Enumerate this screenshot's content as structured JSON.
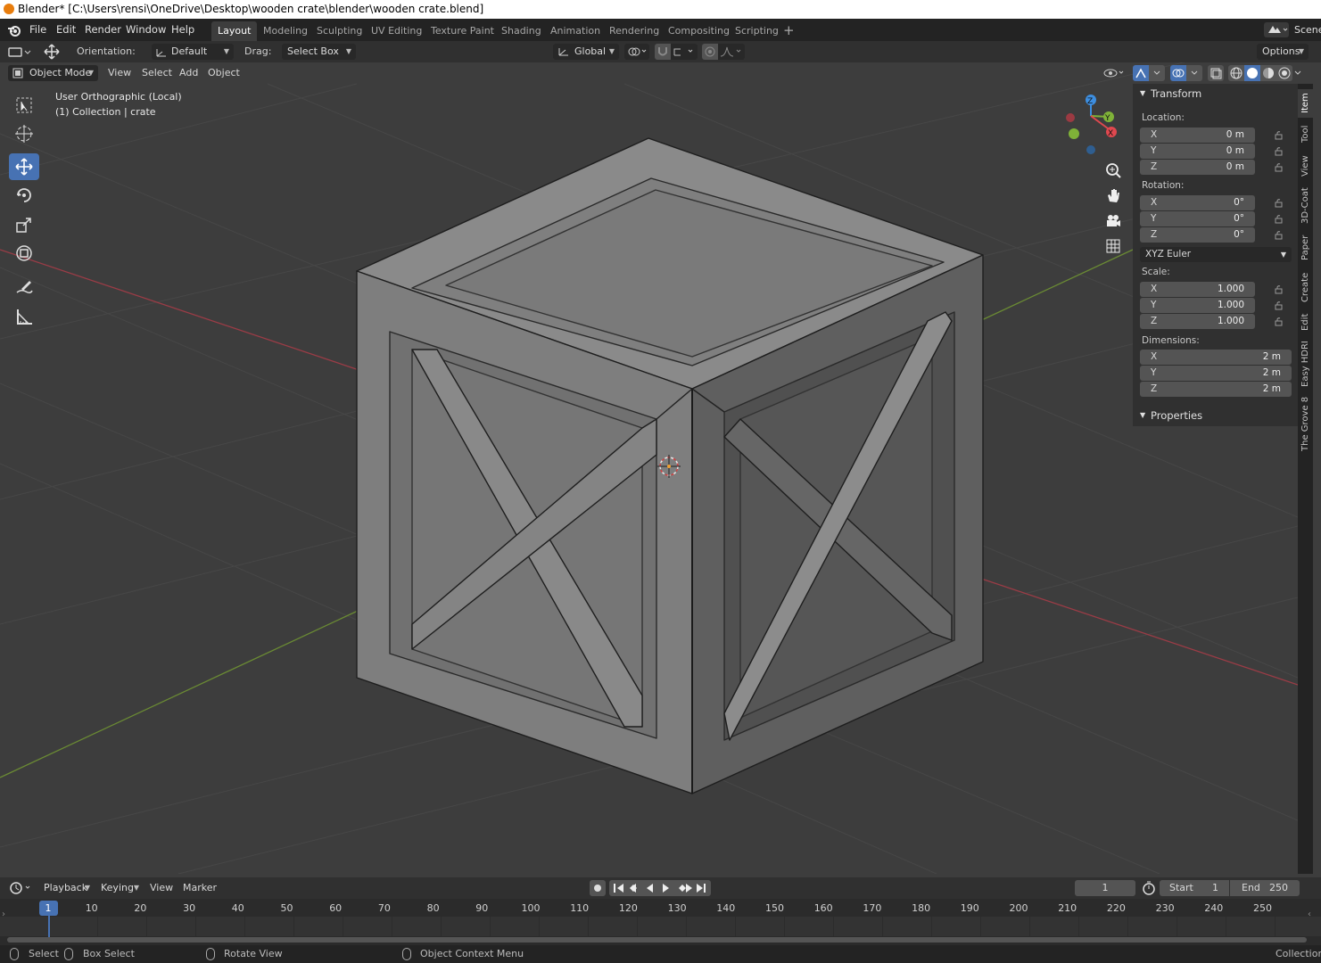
{
  "window": {
    "title": "Blender* [C:\\Users\\rensi\\OneDrive\\Desktop\\wooden crate\\blender\\wooden crate.blend]"
  },
  "menu": [
    "File",
    "Edit",
    "Render",
    "Window",
    "Help"
  ],
  "workspaces": [
    "Layout",
    "Modeling",
    "Sculpting",
    "UV Editing",
    "Texture Paint",
    "Shading",
    "Animation",
    "Rendering",
    "Compositing",
    "Scripting"
  ],
  "active_workspace": "Layout",
  "scene_label": "Scene",
  "toolheader": {
    "orientation_label": "Orientation:",
    "orientation_value": "Default",
    "drag_label": "Drag:",
    "drag_value": "Select Box",
    "transform_orientation": "Global",
    "options_label": "Options"
  },
  "viewport_header": {
    "mode": "Object Mode",
    "menus": [
      "View",
      "Select",
      "Add",
      "Object"
    ]
  },
  "viewport_info": {
    "line1": "User Orthographic (Local)",
    "line2": "(1) Collection | crate"
  },
  "gizmo_axes": {
    "x": "X",
    "y": "Y",
    "z": "Z"
  },
  "npanel": {
    "transform_title": "Transform",
    "location_label": "Location:",
    "location": [
      {
        "axis": "X",
        "value": "0 m"
      },
      {
        "axis": "Y",
        "value": "0 m"
      },
      {
        "axis": "Z",
        "value": "0 m"
      }
    ],
    "rotation_label": "Rotation:",
    "rotation": [
      {
        "axis": "X",
        "value": "0°"
      },
      {
        "axis": "Y",
        "value": "0°"
      },
      {
        "axis": "Z",
        "value": "0°"
      }
    ],
    "rotation_mode": "XYZ Euler",
    "scale_label": "Scale:",
    "scale": [
      {
        "axis": "X",
        "value": "1.000"
      },
      {
        "axis": "Y",
        "value": "1.000"
      },
      {
        "axis": "Z",
        "value": "1.000"
      }
    ],
    "dimensions_label": "Dimensions:",
    "dimensions": [
      {
        "axis": "X",
        "value": "2 m"
      },
      {
        "axis": "Y",
        "value": "2 m"
      },
      {
        "axis": "Z",
        "value": "2 m"
      }
    ],
    "properties_title": "Properties"
  },
  "vertical_tabs": [
    "Item",
    "Tool",
    "View",
    "3D-Coat",
    "Paper",
    "Create",
    "Edit",
    "Easy HDRI",
    "The Grove 8"
  ],
  "timeline": {
    "menus": [
      "Playback",
      "Keying",
      "View",
      "Marker"
    ],
    "current_frame": "1",
    "start_label": "Start",
    "start_value": "1",
    "end_label": "End",
    "end_value": "250",
    "ruler": [
      "1",
      "10",
      "20",
      "30",
      "40",
      "50",
      "60",
      "70",
      "80",
      "90",
      "100",
      "110",
      "120",
      "130",
      "140",
      "150",
      "160",
      "170",
      "180",
      "190",
      "200",
      "210",
      "220",
      "230",
      "240",
      "250"
    ]
  },
  "statusbar": {
    "select": "Select",
    "box_select": "Box Select",
    "rotate_view": "Rotate View",
    "context_menu": "Object Context Menu",
    "collection": "Collection"
  },
  "colors": {
    "accent": "#4772b3",
    "axis_x": "#e0484f",
    "axis_y": "#7fb238",
    "axis_z": "#3d8ee0"
  }
}
